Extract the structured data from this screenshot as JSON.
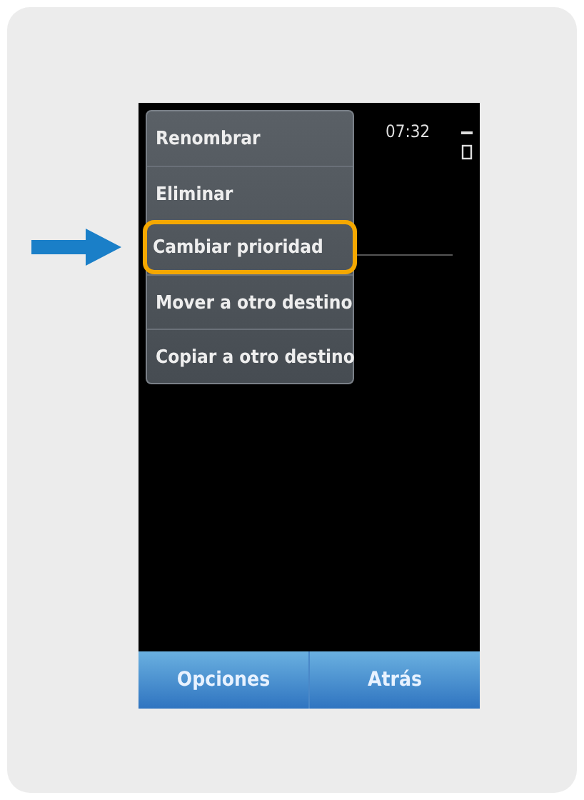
{
  "status_bar": {
    "time": "07:32"
  },
  "menu": {
    "items": [
      {
        "label": "Renombrar",
        "selected": false
      },
      {
        "label": "Eliminar",
        "selected": false
      },
      {
        "label": "Cambiar prioridad",
        "selected": true
      },
      {
        "label": "Mover a otro destino",
        "selected": false
      },
      {
        "label": "Copiar a otro destino",
        "selected": false
      }
    ]
  },
  "softkeys": [
    "Opciones",
    "Atrás"
  ]
}
